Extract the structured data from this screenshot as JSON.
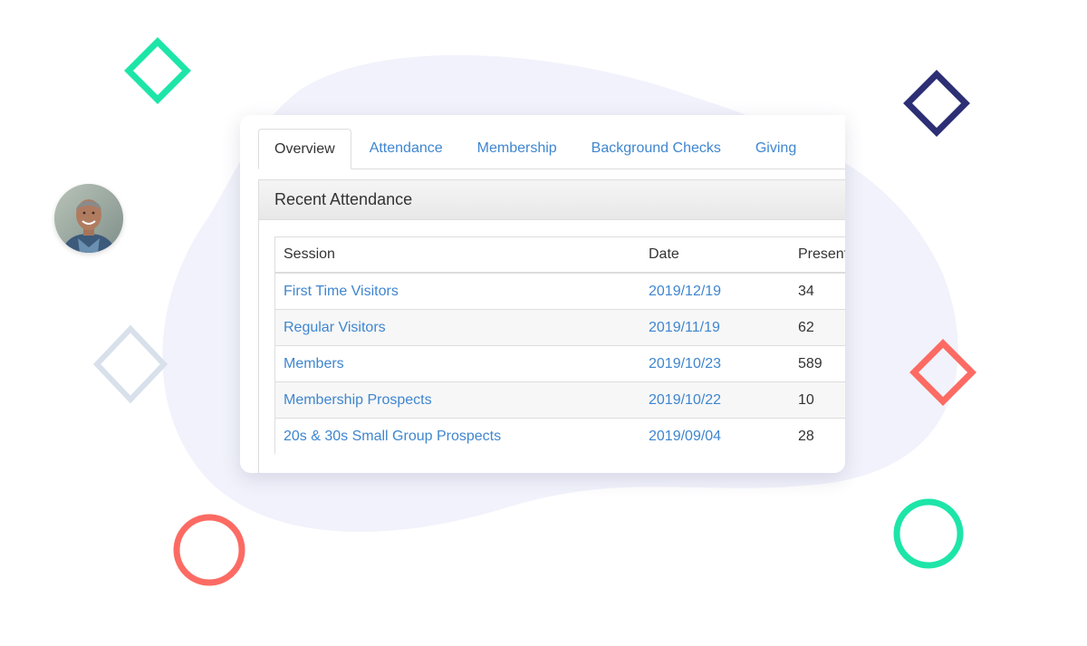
{
  "tabs": [
    {
      "label": "Overview",
      "active": true
    },
    {
      "label": "Attendance",
      "active": false
    },
    {
      "label": "Membership",
      "active": false
    },
    {
      "label": "Background Checks",
      "active": false
    },
    {
      "label": "Giving",
      "active": false
    }
  ],
  "panel": {
    "title": "Recent Attendance"
  },
  "table": {
    "headers": {
      "session": "Session",
      "date": "Date",
      "present": "Present"
    },
    "rows": [
      {
        "session": "First Time Visitors",
        "date": "2019/12/19",
        "present": "34"
      },
      {
        "session": "Regular Visitors",
        "date": "2019/11/19",
        "present": "62"
      },
      {
        "session": "Members",
        "date": "2019/10/23",
        "present": "589"
      },
      {
        "session": "Membership Prospects",
        "date": "2019/10/22",
        "present": "10"
      },
      {
        "session": "20s & 30s Small Group Prospects",
        "date": "2019/09/04",
        "present": "28"
      }
    ]
  },
  "colors": {
    "link": "#3f86cf",
    "text": "#333333",
    "green": "#1de5a8",
    "navy": "#2c2f74",
    "coral": "#fc6b63",
    "grey_diamond": "#d8e0eb",
    "blob": "#f1f2fb"
  },
  "decorations": {
    "avatar_icon": "person-avatar-icon",
    "shapes": [
      "diamond-outline-icon",
      "circle-outline-icon"
    ]
  }
}
